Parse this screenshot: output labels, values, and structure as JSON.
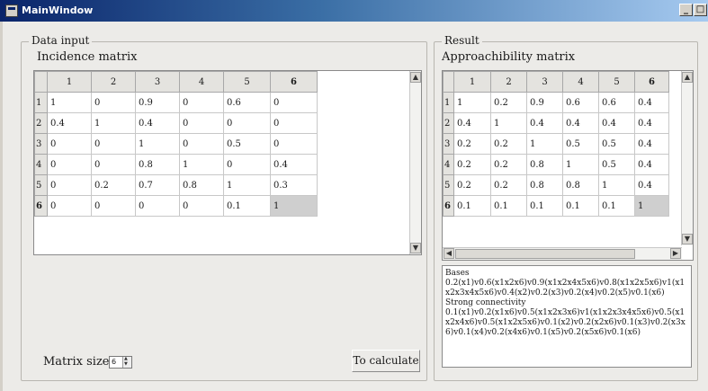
{
  "window": {
    "title": "MainWindow",
    "min": "_",
    "max": "□"
  },
  "data_input": {
    "group_title": "Data input",
    "table_label": "Incidence matrix",
    "columns": [
      "1",
      "2",
      "3",
      "4",
      "5",
      "6"
    ],
    "row_headers": [
      "1",
      "2",
      "3",
      "4",
      "5",
      "6"
    ],
    "rows": [
      [
        "1",
        "0",
        "0.9",
        "0",
        "0.6",
        "0"
      ],
      [
        "0.4",
        "1",
        "0.4",
        "0",
        "0",
        "0"
      ],
      [
        "0",
        "0",
        "1",
        "0",
        "0.5",
        "0"
      ],
      [
        "0",
        "0",
        "0.8",
        "1",
        "0",
        "0.4"
      ],
      [
        "0",
        "0.2",
        "0.7",
        "0.8",
        "1",
        "0.3"
      ],
      [
        "0",
        "0",
        "0",
        "0",
        "0.1",
        "1"
      ]
    ],
    "matrix_size_label": "Matrix size",
    "matrix_size_value": "6",
    "calculate_label": "To calculate"
  },
  "result": {
    "group_title": "Result",
    "table_label": "Approachibility matrix",
    "columns": [
      "1",
      "2",
      "3",
      "4",
      "5",
      "6"
    ],
    "row_headers": [
      "1",
      "2",
      "3",
      "4",
      "5",
      "6"
    ],
    "rows": [
      [
        "1",
        "0.2",
        "0.9",
        "0.6",
        "0.6",
        "0.4"
      ],
      [
        "0.4",
        "1",
        "0.4",
        "0.4",
        "0.4",
        "0.4"
      ],
      [
        "0.2",
        "0.2",
        "1",
        "0.5",
        "0.5",
        "0.4"
      ],
      [
        "0.2",
        "0.2",
        "0.8",
        "1",
        "0.5",
        "0.4"
      ],
      [
        "0.2",
        "0.2",
        "0.8",
        "0.8",
        "1",
        "0.4"
      ],
      [
        "0.1",
        "0.1",
        "0.1",
        "0.1",
        "0.1",
        "1"
      ]
    ],
    "output_lines": [
      "Bases",
      "0.2(x1)v0.6(x1x2x6)v0.9(x1x2x4x5x6)v0.8(x1x2x5x6)v1(x1x2x3x4x5x6)v0.4(x2)v0.2(x3)v0.2(x4)v0.2(x5)v0.1(x6)",
      "Strong connectivity",
      "0.1(x1)v0.2(x1x6)v0.5(x1x2x3x6)v1(x1x2x3x4x5x6)v0.5(x1x2x4x6)v0.5(x1x2x5x6)v0.1(x2)v0.2(x2x6)v0.1(x3)v0.2(x3x6)v0.1(x4)v0.2(x4x6)v0.1(x5)v0.2(x5x6)v0.1(x6)"
    ]
  }
}
